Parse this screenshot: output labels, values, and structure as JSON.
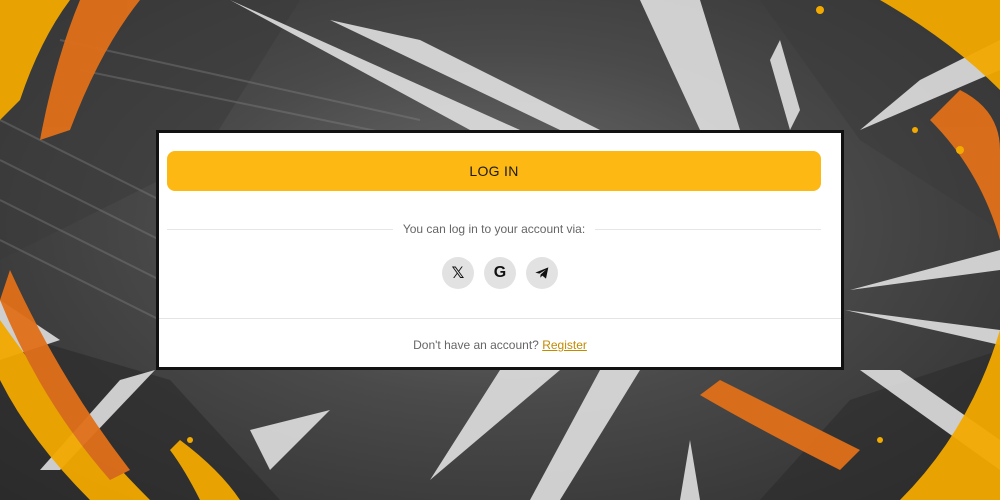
{
  "modal": {
    "login_button_label": "LOG IN",
    "divider_text": "You can log in to your account via:",
    "social_buttons": [
      {
        "icon": "x-icon",
        "glyph": "𝕏"
      },
      {
        "icon": "google-icon",
        "glyph": "G"
      },
      {
        "icon": "telegram-icon"
      }
    ],
    "footer": {
      "prompt": "Don't have an account?",
      "register_link": "Register"
    }
  },
  "colors": {
    "accent": "#fdb813",
    "link": "#c28a00",
    "modal_border": "#111111",
    "background_accent": "#f2a900"
  }
}
